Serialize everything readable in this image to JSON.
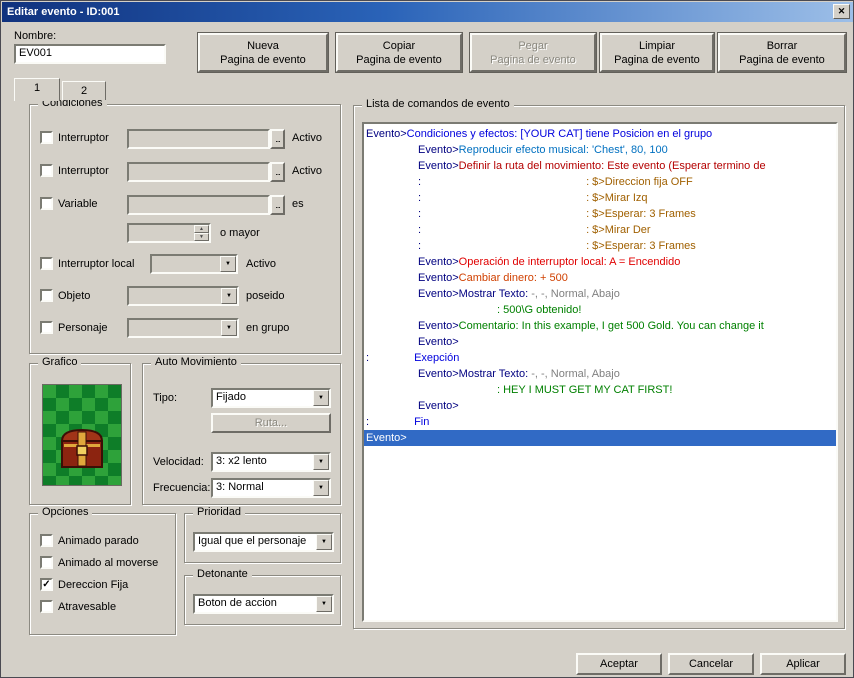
{
  "window": {
    "title": "Editar evento - ID:001"
  },
  "icons": {
    "close": "✕",
    "dropdown": "▼",
    "up": "▲",
    "down": "▼",
    "browse": "...",
    "check": "✓"
  },
  "name_field": {
    "label": "Nombre:",
    "value": "EV001"
  },
  "page_buttons": [
    {
      "line1": "Nueva",
      "line2": "Pagina de evento",
      "enabled": true
    },
    {
      "line1": "Copiar",
      "line2": "Pagina de evento",
      "enabled": true
    },
    {
      "line1": "Pegar",
      "line2": "Pagina de evento",
      "enabled": false
    },
    {
      "line1": "Limpiar",
      "line2": "Pagina de evento",
      "enabled": true
    },
    {
      "line1": "Borrar",
      "line2": "Pagina de evento",
      "enabled": true
    }
  ],
  "tabs": [
    {
      "label": "1",
      "active": true
    },
    {
      "label": "2",
      "active": false
    }
  ],
  "conditions": {
    "title": "Condiciones",
    "rows": {
      "switch1": {
        "label": "Interruptor",
        "value": "",
        "suffix": "Activo",
        "checked": false
      },
      "switch2": {
        "label": "Interruptor",
        "value": "",
        "suffix": "Activo",
        "checked": false
      },
      "variable": {
        "label": "Variable",
        "value": "",
        "suffix": "es",
        "checked": false
      },
      "variable_compare": {
        "value": "",
        "suffix": "o mayor"
      },
      "local_switch": {
        "label": "Interruptor local",
        "value": "",
        "suffix": "Activo",
        "checked": false
      },
      "item": {
        "label": "Objeto",
        "value": "",
        "suffix": "poseido",
        "checked": false
      },
      "actor": {
        "label": "Personaje",
        "value": "",
        "suffix": "en grupo",
        "checked": false
      }
    }
  },
  "graphic": {
    "title": "Grafico"
  },
  "auto_movement": {
    "title": "Auto Movimiento",
    "type_label": "Tipo:",
    "type_value": "Fijado",
    "route_button": "Ruta...",
    "speed_label": "Velocidad:",
    "speed_value": "3: x2 lento",
    "freq_label": "Frecuencia:",
    "freq_value": "3: Normal"
  },
  "options": {
    "title": "Opciones",
    "items": [
      {
        "label": "Animado parado",
        "checked": false
      },
      {
        "label": "Animado al moverse",
        "checked": false
      },
      {
        "label": "Dereccion Fija",
        "checked": true
      },
      {
        "label": "Atravesable",
        "checked": false
      }
    ]
  },
  "priority": {
    "title": "Prioridad",
    "value": "Igual que el personaje"
  },
  "trigger": {
    "title": "Detonante",
    "value": "Boton de accion"
  },
  "command_list": {
    "title": "Lista de comandos de evento",
    "lines": [
      {
        "indent": 0,
        "segments": [
          {
            "text": "Evento>",
            "color": "navy"
          },
          {
            "text": "Condiciones y efectos: [YOUR CAT] tiene Posicion en el grupo",
            "color": "blue"
          }
        ]
      },
      {
        "indent": 1,
        "segments": [
          {
            "text": "Evento>",
            "color": "navy"
          },
          {
            "text": "Reproducir efecto musical: 'Chest', 80, 100",
            "color": "sound"
          }
        ]
      },
      {
        "indent": 1,
        "segments": [
          {
            "text": "Evento>",
            "color": "navy"
          },
          {
            "text": "Definir la ruta del movimiento: Este evento (Esperar termino de",
            "color": "route"
          }
        ]
      },
      {
        "indent": 1,
        "segments": [
          {
            "text": ":",
            "color": "navy"
          },
          {
            "text": ": $>Direccion fija OFF",
            "color": "routestep",
            "pad": 165
          }
        ]
      },
      {
        "indent": 1,
        "segments": [
          {
            "text": ":",
            "color": "navy"
          },
          {
            "text": ": $>Mirar Izq",
            "color": "routestep",
            "pad": 165
          }
        ]
      },
      {
        "indent": 1,
        "segments": [
          {
            "text": ":",
            "color": "navy"
          },
          {
            "text": ": $>Esperar: 3 Frames",
            "color": "routestep",
            "pad": 165
          }
        ]
      },
      {
        "indent": 1,
        "segments": [
          {
            "text": ":",
            "color": "navy"
          },
          {
            "text": ": $>Mirar Der",
            "color": "routestep",
            "pad": 165
          }
        ]
      },
      {
        "indent": 1,
        "segments": [
          {
            "text": ":",
            "color": "navy"
          },
          {
            "text": ": $>Esperar: 3 Frames",
            "color": "routestep",
            "pad": 165
          }
        ]
      },
      {
        "indent": 1,
        "segments": [
          {
            "text": "Evento>",
            "color": "navy"
          },
          {
            "text": "Operación de interruptor local: A = Encendido",
            "color": "switchop"
          }
        ]
      },
      {
        "indent": 1,
        "segments": [
          {
            "text": "Evento>",
            "color": "navy"
          },
          {
            "text": "Cambiar dinero: + 500",
            "color": "money"
          }
        ]
      },
      {
        "indent": 1,
        "segments": [
          {
            "text": "Evento>",
            "color": "navy"
          },
          {
            "text": "Mostrar Texto: ",
            "color": "navy"
          },
          {
            "text": "-, -, Normal, Abajo",
            "color": "gray"
          }
        ]
      },
      {
        "indent": 1,
        "segments": [
          {
            "text": ": 500\\G obtenido!",
            "color": "green",
            "pad": 79
          }
        ]
      },
      {
        "indent": 1,
        "segments": [
          {
            "text": "Evento>",
            "color": "navy"
          },
          {
            "text": "Comentario: In this example, I get 500 Gold. You can change it",
            "color": "green"
          }
        ]
      },
      {
        "indent": 1,
        "segments": [
          {
            "text": "Evento>",
            "color": "navy"
          }
        ]
      },
      {
        "indent": 0,
        "segments": [
          {
            "text": ":",
            "color": "navy"
          },
          {
            "text": "Exepción",
            "color": "blue",
            "pad": 45
          }
        ]
      },
      {
        "indent": 1,
        "segments": [
          {
            "text": "Evento>",
            "color": "navy"
          },
          {
            "text": "Mostrar Texto: ",
            "color": "navy"
          },
          {
            "text": "-, -, Normal, Abajo",
            "color": "gray"
          }
        ]
      },
      {
        "indent": 1,
        "segments": [
          {
            "text": ": HEY I MUST GET MY CAT FIRST!",
            "color": "green",
            "pad": 79
          }
        ]
      },
      {
        "indent": 1,
        "segments": [
          {
            "text": "Evento>",
            "color": "navy"
          }
        ]
      },
      {
        "indent": 0,
        "segments": [
          {
            "text": ":",
            "color": "navy"
          },
          {
            "text": "Fin",
            "color": "blue",
            "pad": 45
          }
        ]
      },
      {
        "indent": 0,
        "selected": true,
        "segments": [
          {
            "text": "Evento>",
            "color": "white"
          }
        ]
      }
    ]
  },
  "footer_buttons": {
    "ok": "Aceptar",
    "cancel": "Cancelar",
    "apply": "Aplicar"
  },
  "colors": {
    "navy": "#000080",
    "blue": "#0000dd",
    "sound": "#0070c0",
    "route": "#b40000",
    "routestep": "#a06000",
    "switchop": "#e00000",
    "money": "#d04000",
    "gray": "#808080",
    "green": "#008000",
    "white": "#ffffff",
    "selection_bg": "#316ac5"
  }
}
